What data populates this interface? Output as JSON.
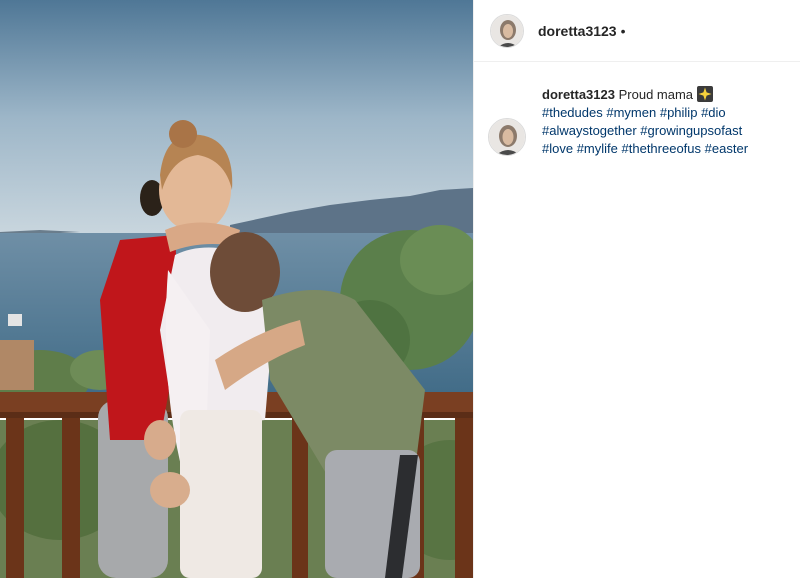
{
  "post": {
    "username": "doretta3123",
    "follow_dot": "•",
    "caption": {
      "text": "Proud mama",
      "emoji_icon": "sparkle-emoji-icon",
      "hashtags": [
        "#thedudes",
        "#mymen",
        "#philip",
        "#dio",
        "#alwaystogether",
        "#growingupsofast",
        "#love",
        "#mylife",
        "#thethreeofus",
        "#easter"
      ]
    }
  },
  "colors": {
    "hashtag": "#00376b",
    "text": "#262626",
    "divider": "#efefef"
  }
}
